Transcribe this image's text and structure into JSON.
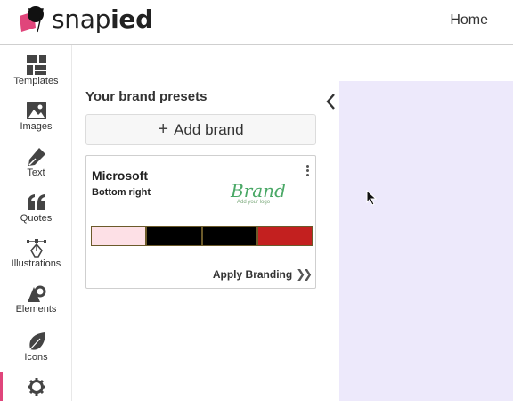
{
  "header": {
    "logo_text_regular": "snap",
    "logo_text_bold": "ied",
    "home_label": "Home"
  },
  "sidebar": {
    "items": [
      {
        "label": "Templates",
        "icon": "templates-icon"
      },
      {
        "label": "Images",
        "icon": "images-icon"
      },
      {
        "label": "Text",
        "icon": "pen-icon"
      },
      {
        "label": "Quotes",
        "icon": "quote-icon"
      },
      {
        "label": "Illustrations",
        "icon": "vector-pen-icon"
      },
      {
        "label": "Elements",
        "icon": "shapes-icon"
      },
      {
        "label": "Icons",
        "icon": "leaf-icon"
      },
      {
        "label": "",
        "icon": "gear-icon"
      }
    ],
    "active_color": "#e0457b"
  },
  "panel": {
    "title": "Your brand presets",
    "add_brand_label": "Add brand",
    "brand": {
      "name": "Microsoft",
      "position": "Bottom right",
      "logo_text": "Brand",
      "logo_subtext": "Add your logo",
      "swatches": [
        "#fde0e6",
        "#000000",
        "#000000",
        "#c3201f"
      ],
      "apply_label": "Apply Branding"
    }
  },
  "canvas": {
    "background": "#ede9fb"
  }
}
